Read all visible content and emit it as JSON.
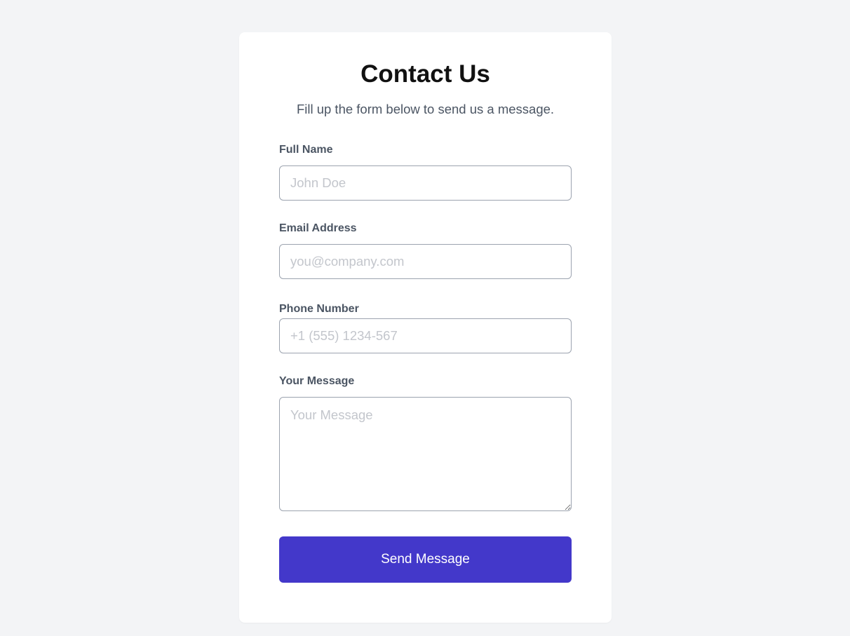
{
  "header": {
    "title": "Contact Us",
    "subtitle": "Fill up the form below to send us a message."
  },
  "form": {
    "full_name": {
      "label": "Full Name",
      "value": "",
      "placeholder": "John Doe"
    },
    "email": {
      "label": "Email Address",
      "value": "",
      "placeholder": "you@company.com"
    },
    "phone": {
      "label": "Phone Number",
      "value": "",
      "placeholder": "+1 (555) 1234-567"
    },
    "message": {
      "label": "Your Message",
      "value": "",
      "placeholder": "Your Message"
    },
    "submit_label": "Send Message"
  },
  "colors": {
    "page_background": "#f3f4f6",
    "card_background": "#ffffff",
    "accent": "#4338ca",
    "label_text": "#4b5563",
    "input_border": "#9ca3af",
    "placeholder_text": "#c3c6cc"
  }
}
